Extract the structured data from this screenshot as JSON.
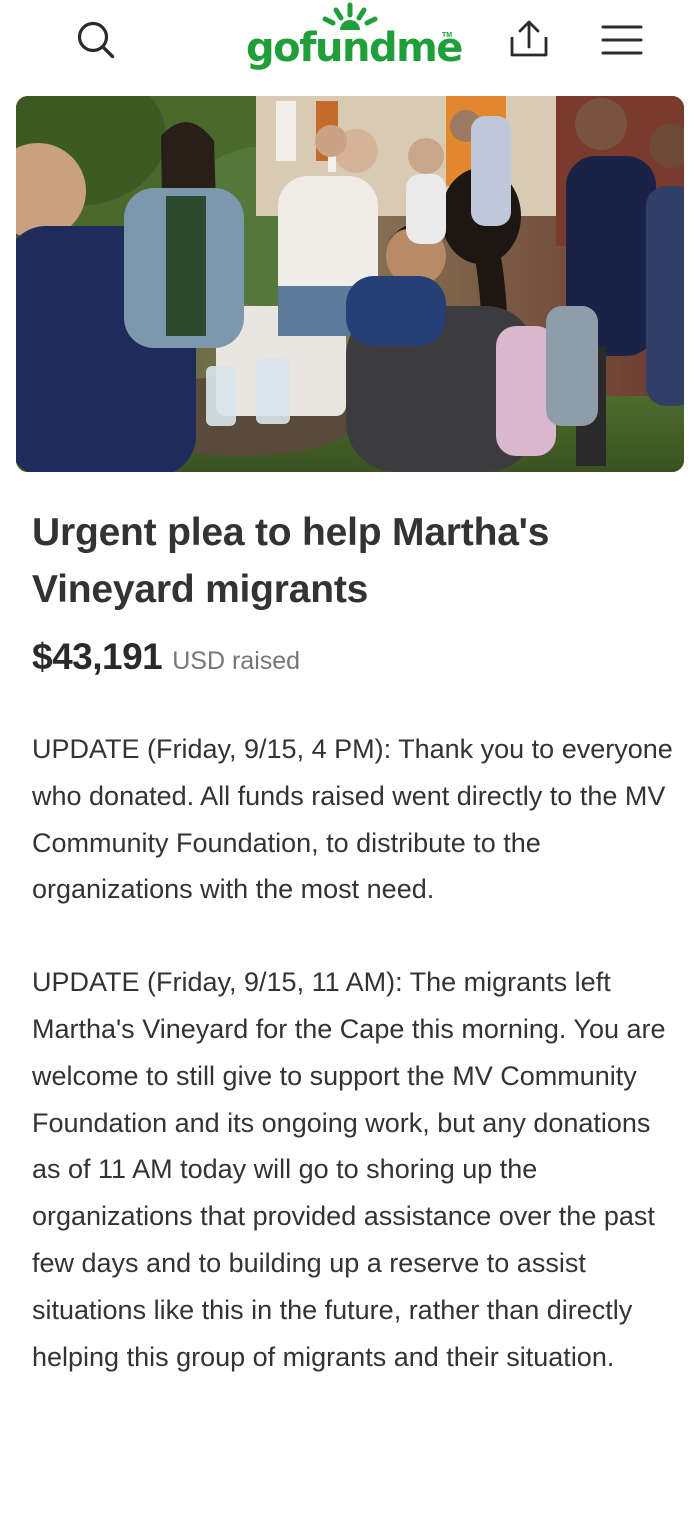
{
  "header": {
    "brand": "gofundme",
    "brand_mark": "TM",
    "icons": {
      "search": "search-icon",
      "share": "share-icon",
      "menu": "hamburger-menu-icon"
    },
    "brand_color": "#1f9e3a"
  },
  "campaign": {
    "hero_image": "photo of volunteers at a table handing out water to migrants",
    "title": "Urgent plea to help Martha's Vineyard migrants",
    "amount_raised": "$43,191",
    "amount_suffix": "USD raised",
    "updates": [
      "UPDATE (Friday, 9/15, 4 PM): Thank you to everyone who donated. All funds raised went directly to the MV Community Foundation, to distribute to the organizations with the most need.",
      "UPDATE (Friday, 9/15, 11 AM): The migrants left Martha's Vineyard for the Cape this morning. You are welcome to still give to support the MV Community Foundation and its ongoing work, but any donations as of 11 AM today will go to shoring up the organizations that provided assistance over the past few days and to building up a reserve to assist situations like this in the future, rather than directly helping this group of migrants and their situation."
    ]
  }
}
